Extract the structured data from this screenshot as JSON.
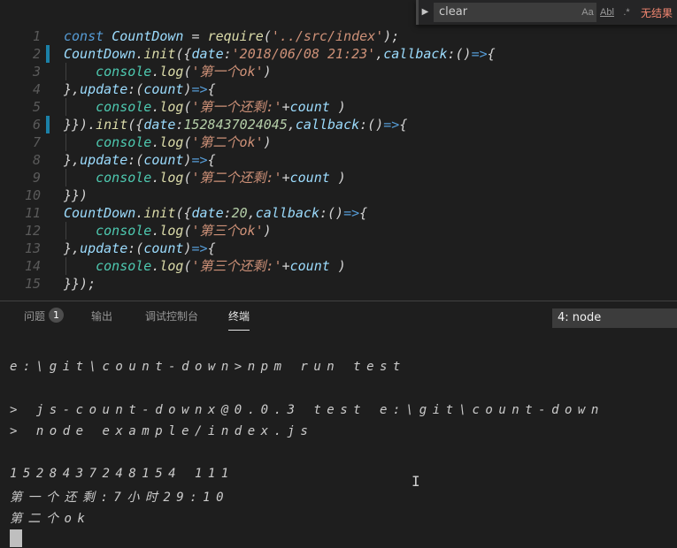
{
  "colors": {
    "keyword": "#569cd6",
    "identifier": "#9cdcfe",
    "function": "#dcdcaa",
    "string": "#ce9178",
    "number": "#b5cea8",
    "punctuation": "#d4d4d4",
    "console": "#4ec9b0",
    "modified_gutter": "#1b81a8",
    "find_result_error": "#f48771"
  },
  "editor": {
    "lines": [
      {
        "num": "1",
        "mark": false,
        "indent": false,
        "tokens": [
          {
            "t": "const ",
            "c": "keyword"
          },
          {
            "t": "CountDown",
            "c": "identifier"
          },
          {
            "t": " = ",
            "c": "punctuation"
          },
          {
            "t": "require",
            "c": "function"
          },
          {
            "t": "(",
            "c": "punctuation"
          },
          {
            "t": "'../src/index'",
            "c": "string"
          },
          {
            "t": ");",
            "c": "punctuation"
          }
        ]
      },
      {
        "num": "2",
        "mark": true,
        "indent": false,
        "tokens": [
          {
            "t": "CountDown",
            "c": "identifier"
          },
          {
            "t": ".",
            "c": "punctuation"
          },
          {
            "t": "init",
            "c": "function"
          },
          {
            "t": "({",
            "c": "punctuation"
          },
          {
            "t": "date",
            "c": "identifier"
          },
          {
            "t": ":",
            "c": "punctuation"
          },
          {
            "t": "'2018/06/08 21:23'",
            "c": "string"
          },
          {
            "t": ",",
            "c": "punctuation"
          },
          {
            "t": "callback",
            "c": "identifier"
          },
          {
            "t": ":()",
            "c": "punctuation"
          },
          {
            "t": "=>",
            "c": "keyword"
          },
          {
            "t": "{",
            "c": "punctuation"
          }
        ]
      },
      {
        "num": "3",
        "mark": false,
        "indent": true,
        "tokens": [
          {
            "t": "    ",
            "c": "punctuation"
          },
          {
            "t": "console",
            "c": "console"
          },
          {
            "t": ".",
            "c": "punctuation"
          },
          {
            "t": "log",
            "c": "function"
          },
          {
            "t": "(",
            "c": "punctuation"
          },
          {
            "t": "'第一个ok'",
            "c": "string"
          },
          {
            "t": ")",
            "c": "punctuation"
          }
        ]
      },
      {
        "num": "4",
        "mark": false,
        "indent": false,
        "tokens": [
          {
            "t": "},",
            "c": "punctuation"
          },
          {
            "t": "update",
            "c": "identifier"
          },
          {
            "t": ":(",
            "c": "punctuation"
          },
          {
            "t": "count",
            "c": "identifier"
          },
          {
            "t": ")",
            "c": "punctuation"
          },
          {
            "t": "=>",
            "c": "keyword"
          },
          {
            "t": "{",
            "c": "punctuation"
          }
        ]
      },
      {
        "num": "5",
        "mark": false,
        "indent": true,
        "tokens": [
          {
            "t": "    ",
            "c": "punctuation"
          },
          {
            "t": "console",
            "c": "console"
          },
          {
            "t": ".",
            "c": "punctuation"
          },
          {
            "t": "log",
            "c": "function"
          },
          {
            "t": "(",
            "c": "punctuation"
          },
          {
            "t": "'第一个还剩:'",
            "c": "string"
          },
          {
            "t": "+",
            "c": "punctuation"
          },
          {
            "t": "count",
            "c": "identifier"
          },
          {
            "t": " )",
            "c": "punctuation"
          }
        ]
      },
      {
        "num": "6",
        "mark": true,
        "indent": false,
        "tokens": [
          {
            "t": "}}).",
            "c": "punctuation"
          },
          {
            "t": "init",
            "c": "function"
          },
          {
            "t": "({",
            "c": "punctuation"
          },
          {
            "t": "date",
            "c": "identifier"
          },
          {
            "t": ":",
            "c": "punctuation"
          },
          {
            "t": "1528437024045",
            "c": "number"
          },
          {
            "t": ",",
            "c": "punctuation"
          },
          {
            "t": "callback",
            "c": "identifier"
          },
          {
            "t": ":()",
            "c": "punctuation"
          },
          {
            "t": "=>",
            "c": "keyword"
          },
          {
            "t": "{",
            "c": "punctuation"
          }
        ]
      },
      {
        "num": "7",
        "mark": false,
        "indent": true,
        "tokens": [
          {
            "t": "    ",
            "c": "punctuation"
          },
          {
            "t": "console",
            "c": "console"
          },
          {
            "t": ".",
            "c": "punctuation"
          },
          {
            "t": "log",
            "c": "function"
          },
          {
            "t": "(",
            "c": "punctuation"
          },
          {
            "t": "'第二个ok'",
            "c": "string"
          },
          {
            "t": ")",
            "c": "punctuation"
          }
        ]
      },
      {
        "num": "8",
        "mark": false,
        "indent": false,
        "tokens": [
          {
            "t": "},",
            "c": "punctuation"
          },
          {
            "t": "update",
            "c": "identifier"
          },
          {
            "t": ":(",
            "c": "punctuation"
          },
          {
            "t": "count",
            "c": "identifier"
          },
          {
            "t": ")",
            "c": "punctuation"
          },
          {
            "t": "=>",
            "c": "keyword"
          },
          {
            "t": "{",
            "c": "punctuation"
          }
        ]
      },
      {
        "num": "9",
        "mark": false,
        "indent": true,
        "tokens": [
          {
            "t": "    ",
            "c": "punctuation"
          },
          {
            "t": "console",
            "c": "console"
          },
          {
            "t": ".",
            "c": "punctuation"
          },
          {
            "t": "log",
            "c": "function"
          },
          {
            "t": "(",
            "c": "punctuation"
          },
          {
            "t": "'第二个还剩:'",
            "c": "string"
          },
          {
            "t": "+",
            "c": "punctuation"
          },
          {
            "t": "count",
            "c": "identifier"
          },
          {
            "t": " )",
            "c": "punctuation"
          }
        ]
      },
      {
        "num": "10",
        "mark": false,
        "indent": false,
        "tokens": [
          {
            "t": "}})",
            "c": "punctuation"
          }
        ]
      },
      {
        "num": "11",
        "mark": false,
        "indent": false,
        "tokens": [
          {
            "t": "CountDown",
            "c": "identifier"
          },
          {
            "t": ".",
            "c": "punctuation"
          },
          {
            "t": "init",
            "c": "function"
          },
          {
            "t": "({",
            "c": "punctuation"
          },
          {
            "t": "date",
            "c": "identifier"
          },
          {
            "t": ":",
            "c": "punctuation"
          },
          {
            "t": "20",
            "c": "number"
          },
          {
            "t": ",",
            "c": "punctuation"
          },
          {
            "t": "callback",
            "c": "identifier"
          },
          {
            "t": ":()",
            "c": "punctuation"
          },
          {
            "t": "=>",
            "c": "keyword"
          },
          {
            "t": "{",
            "c": "punctuation"
          }
        ]
      },
      {
        "num": "12",
        "mark": false,
        "indent": true,
        "tokens": [
          {
            "t": "    ",
            "c": "punctuation"
          },
          {
            "t": "console",
            "c": "console"
          },
          {
            "t": ".",
            "c": "punctuation"
          },
          {
            "t": "log",
            "c": "function"
          },
          {
            "t": "(",
            "c": "punctuation"
          },
          {
            "t": "'第三个ok'",
            "c": "string"
          },
          {
            "t": ")",
            "c": "punctuation"
          }
        ]
      },
      {
        "num": "13",
        "mark": false,
        "indent": false,
        "tokens": [
          {
            "t": "},",
            "c": "punctuation"
          },
          {
            "t": "update",
            "c": "identifier"
          },
          {
            "t": ":(",
            "c": "punctuation"
          },
          {
            "t": "count",
            "c": "identifier"
          },
          {
            "t": ")",
            "c": "punctuation"
          },
          {
            "t": "=>",
            "c": "keyword"
          },
          {
            "t": "{",
            "c": "punctuation"
          }
        ]
      },
      {
        "num": "14",
        "mark": false,
        "indent": true,
        "tokens": [
          {
            "t": "    ",
            "c": "punctuation"
          },
          {
            "t": "console",
            "c": "console"
          },
          {
            "t": ".",
            "c": "punctuation"
          },
          {
            "t": "log",
            "c": "function"
          },
          {
            "t": "(",
            "c": "punctuation"
          },
          {
            "t": "'第三个还剩:'",
            "c": "string"
          },
          {
            "t": "+",
            "c": "punctuation"
          },
          {
            "t": "count",
            "c": "identifier"
          },
          {
            "t": " )",
            "c": "punctuation"
          }
        ]
      },
      {
        "num": "15",
        "mark": false,
        "indent": false,
        "tokens": [
          {
            "t": "}});",
            "c": "punctuation"
          }
        ]
      }
    ]
  },
  "find_widget": {
    "toggle_icon": "chevron-right-icon",
    "query": "clear",
    "match_case_label": "Aa",
    "whole_word_label": "Abl",
    "regex_label": ".*",
    "result": "无结果"
  },
  "panel": {
    "tabs": [
      {
        "label": "问题",
        "active": false
      },
      {
        "label": "输出",
        "active": false
      },
      {
        "label": "调试控制台",
        "active": false
      },
      {
        "label": "终端",
        "active": true
      }
    ],
    "problems_count": "1",
    "terminal_selector": "4: node"
  },
  "terminal": {
    "lines": [
      "e:\\git\\count-down>npm run test",
      "> js-count-downx@0.0.3 test e:\\git\\count-down",
      "> node example/index.js",
      "1528437248154 111",
      "第一个还剩:7小时29:10",
      "第二个ok"
    ]
  }
}
